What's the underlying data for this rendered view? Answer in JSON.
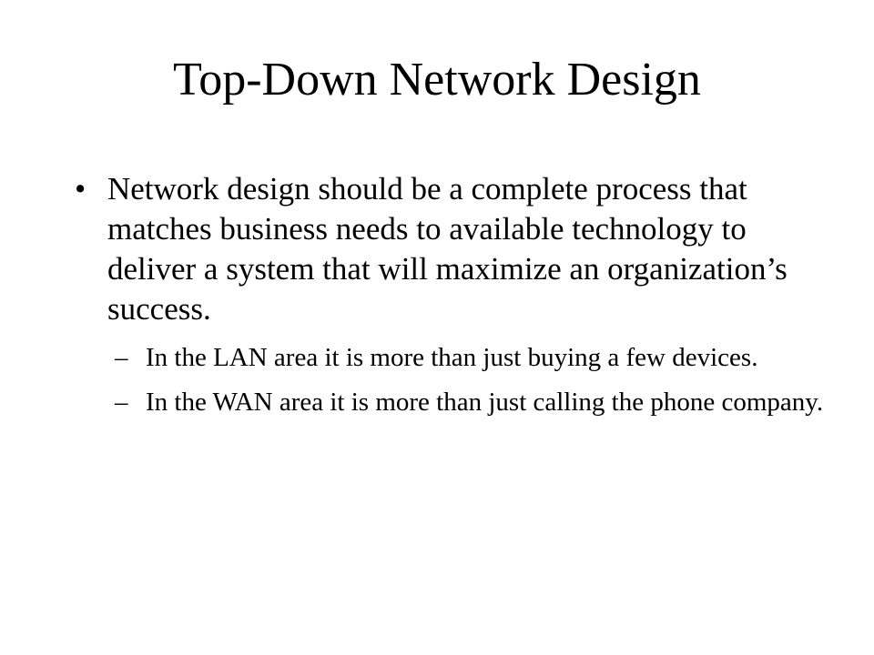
{
  "slide": {
    "title": "Top-Down Network Design",
    "bullets": [
      {
        "marker": "•",
        "text": "Network design should be a complete process that matches business needs to available technology to deliver a system that will maximize an organization’s success.",
        "sub_bullets": [
          {
            "marker": "–",
            "text": "In the LAN area it is more than just buying a few devices."
          },
          {
            "marker": "–",
            "text": "In the WAN area it is more than just calling the phone company."
          }
        ]
      }
    ]
  }
}
